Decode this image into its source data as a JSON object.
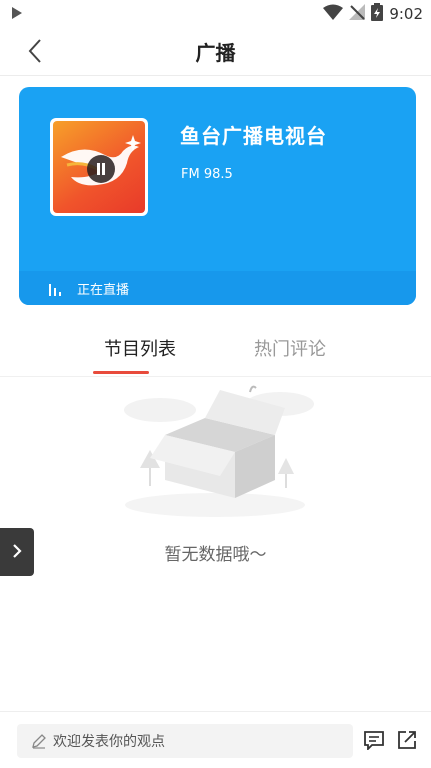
{
  "status_bar": {
    "time": "9:02"
  },
  "header": {
    "title": "广播"
  },
  "station": {
    "name": "鱼台广播电视台",
    "frequency": "FM 98.5",
    "live_label": "正在直播"
  },
  "tabs": [
    {
      "label": "节目列表",
      "active": true
    },
    {
      "label": "热门评论",
      "active": false
    }
  ],
  "empty_state": {
    "message": "暂无数据哦～"
  },
  "bottom_bar": {
    "comment_placeholder": "欢迎发表你的观点"
  },
  "colors": {
    "card_blue": "#1aa2f3",
    "tab_accent": "#e84b3c"
  }
}
